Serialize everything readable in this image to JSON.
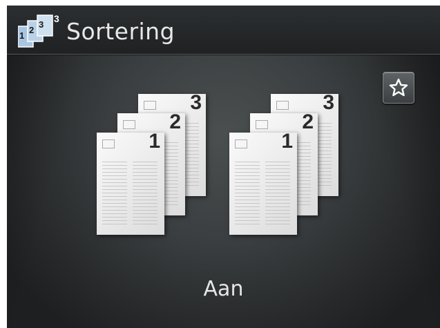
{
  "header": {
    "title": "Sortering",
    "icon": "collate-icon"
  },
  "toolbar": {
    "favorite_icon": "star-icon"
  },
  "illustration": {
    "stacks": [
      {
        "pages": [
          "1",
          "2",
          "3"
        ]
      },
      {
        "pages": [
          "1",
          "2",
          "3"
        ]
      }
    ]
  },
  "setting": {
    "value": "Aan"
  },
  "colors": {
    "background": "#3a3e40",
    "text": "#e8e8e8"
  }
}
